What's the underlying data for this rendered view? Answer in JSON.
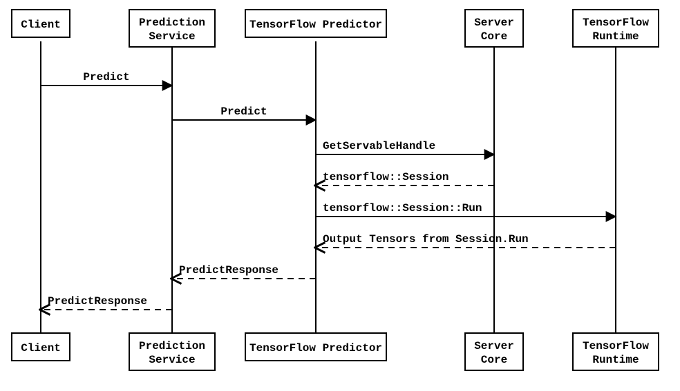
{
  "diagram": {
    "type": "sequence",
    "actors": [
      {
        "id": "client",
        "label": "Client",
        "lines": [
          "Client"
        ]
      },
      {
        "id": "predsvc",
        "label": "Prediction Service",
        "lines": [
          "Prediction",
          "Service"
        ]
      },
      {
        "id": "tfpred",
        "label": "TensorFlow Predictor",
        "lines": [
          "TensorFlow Predictor"
        ]
      },
      {
        "id": "core",
        "label": "Server Core",
        "lines": [
          "Server",
          "Core"
        ]
      },
      {
        "id": "tfrt",
        "label": "TensorFlow Runtime",
        "lines": [
          "TensorFlow",
          "Runtime"
        ]
      }
    ],
    "messages": [
      {
        "from": "client",
        "to": "predsvc",
        "label": "Predict",
        "style": "solid"
      },
      {
        "from": "predsvc",
        "to": "tfpred",
        "label": "Predict",
        "style": "solid"
      },
      {
        "from": "tfpred",
        "to": "core",
        "label": "GetServableHandle",
        "style": "solid"
      },
      {
        "from": "core",
        "to": "tfpred",
        "label": "tensorflow::Session",
        "style": "dashed"
      },
      {
        "from": "tfpred",
        "to": "tfrt",
        "label": "tensorflow::Session::Run",
        "style": "solid"
      },
      {
        "from": "tfrt",
        "to": "tfpred",
        "label": "Output Tensors from Session.Run",
        "style": "dashed"
      },
      {
        "from": "tfpred",
        "to": "predsvc",
        "label": "PredictResponse",
        "style": "dashed"
      },
      {
        "from": "predsvc",
        "to": "client",
        "label": "PredictResponse",
        "style": "dashed"
      }
    ]
  }
}
